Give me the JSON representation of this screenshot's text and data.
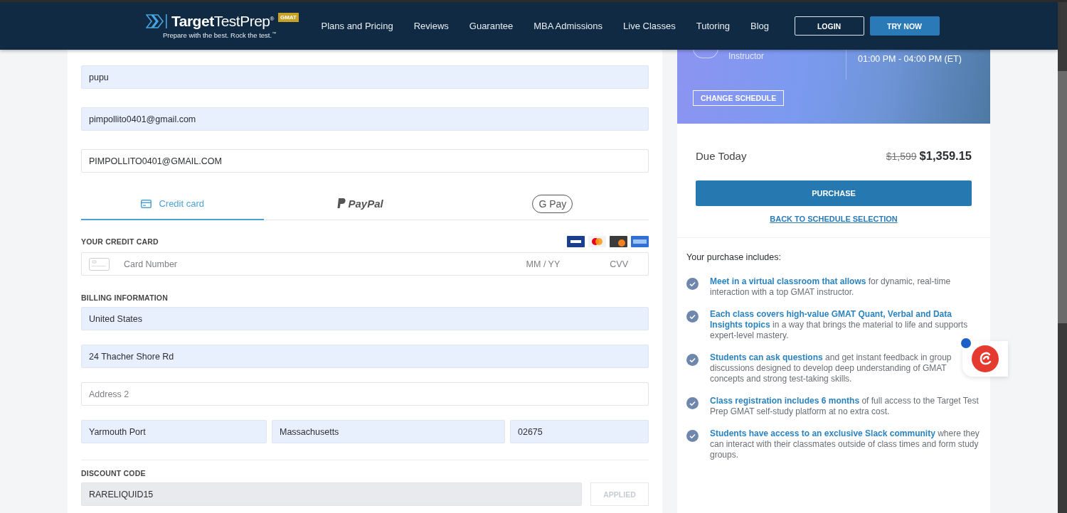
{
  "header": {
    "brand_bold": "Target",
    "brand_light": "TestPrep",
    "brand_mark": "®",
    "badge": "GMAT",
    "tagline": "Prepare with the best. Rock the test.",
    "tagline_mark": "™",
    "nav": [
      "Plans and Pricing",
      "Reviews",
      "Guarantee",
      "MBA Admissions",
      "Live Classes",
      "Tutoring",
      "Blog"
    ],
    "buttons": [
      {
        "label": "LOGIN",
        "kind": "outline"
      },
      {
        "label": "TRY NOW",
        "kind": "solid"
      }
    ]
  },
  "contact_fields": [
    {
      "value": "pupu",
      "kind": "filled"
    },
    {
      "value": "pimpollito0401@gmail.com",
      "kind": "filled"
    },
    {
      "value": "PIMPOLLITO0401@GMAIL.COM",
      "kind": "plain"
    }
  ],
  "payment_tabs": [
    {
      "label": "Credit card",
      "kind": "card",
      "selected": true
    },
    {
      "label": "PayPal",
      "kind": "paypal",
      "selected": false
    },
    {
      "label": "G Pay",
      "kind": "gpay",
      "selected": false
    }
  ],
  "credit_card": {
    "heading": "YOUR CREDIT CARD",
    "number_placeholder": "Card Number",
    "expiry_placeholder": "MM / YY",
    "cvv_placeholder": "CVV"
  },
  "billing": {
    "heading": "BILLING INFORMATION",
    "fields": [
      {
        "value": "United States",
        "kind": "filled"
      },
      {
        "value": "24 Thacher Shore Rd",
        "kind": "filled"
      },
      {
        "placeholder": "Address 2",
        "kind": "plain"
      }
    ],
    "city": "Yarmouth Port",
    "state": "Massachusetts",
    "zip": "02675"
  },
  "discount": {
    "heading": "DISCOUNT CODE",
    "value": "RARELIQUID15",
    "button": "APPLIED",
    "disabled": true
  },
  "schedule": {
    "role": "Instructor",
    "time": "01:00 PM - 04:00 PM (ET)",
    "button": "CHANGE SCHEDULE"
  },
  "summary": {
    "label": "Due Today",
    "old_price": "$1,599",
    "price": "$1,359.15",
    "purchase": "PURCHASE",
    "back_link": "BACK TO SCHEDULE SELECTION"
  },
  "includes": {
    "heading": "Your purchase includes:",
    "items": [
      "**Meet in a virtual classroom that allows** for dynamic, real-time interaction with a top GMAT instructor.",
      "**Each class covers high-value GMAT Quant, Verbal and Data Insights topics** in a way that brings the material to life and supports expert-level mastery.",
      "**Students can ask questions** and get instant feedback in group discussions designed to develop deep understanding of GMAT concepts and strong test-taking skills.",
      "**Class registration includes 6 months** of full access to the Target Test Prep GMAT self-study platform at no extra cost.",
      "**Students have access to an exclusive Slack community** where they can interact with their classmates outside of class times and form study groups."
    ]
  }
}
